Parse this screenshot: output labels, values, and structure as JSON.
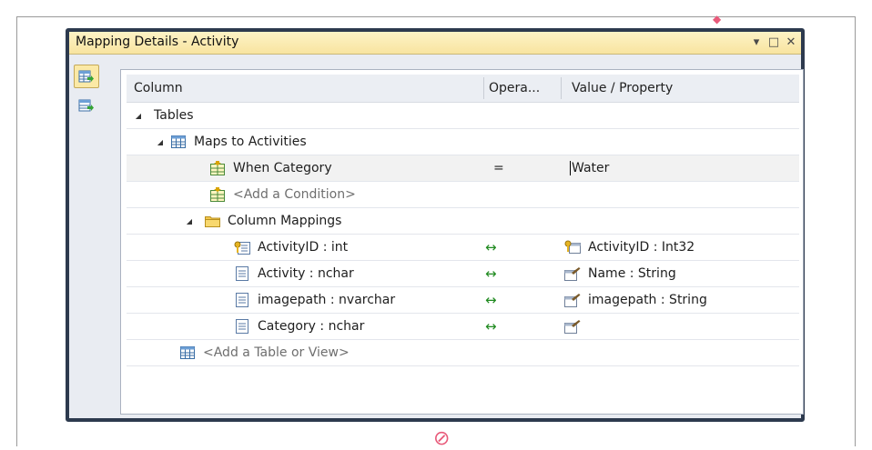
{
  "window": {
    "title": "Mapping Details - Activity",
    "buttons": [
      "▾",
      "□",
      "✕"
    ]
  },
  "columns": {
    "column": "Column",
    "operator": "Opera...",
    "value": "Value / Property"
  },
  "tree": {
    "tables": "Tables",
    "maps_to": "Maps to Activities",
    "condition": {
      "label": "When Category",
      "operator": "=",
      "value": "Water"
    },
    "add_condition": "<Add a Condition>",
    "column_mappings": "Column Mappings",
    "mappings": [
      {
        "column": "ActivityID : int",
        "operator": "↔",
        "property": "ActivityID : Int32"
      },
      {
        "column": "Activity : nchar",
        "operator": "↔",
        "property": "Name : String"
      },
      {
        "column": "imagepath : nvarchar",
        "operator": "↔",
        "property": "imagepath : String"
      },
      {
        "column": "Category : nchar",
        "operator": "↔",
        "property": ""
      }
    ],
    "add_table": "<Add a Table or View>"
  },
  "colors": {
    "title_bar": "#f8e4a0",
    "frame": "#2d3a4e",
    "panel_bg": "#e9ecf2",
    "mapping_arrow": "#1f8a1f"
  }
}
